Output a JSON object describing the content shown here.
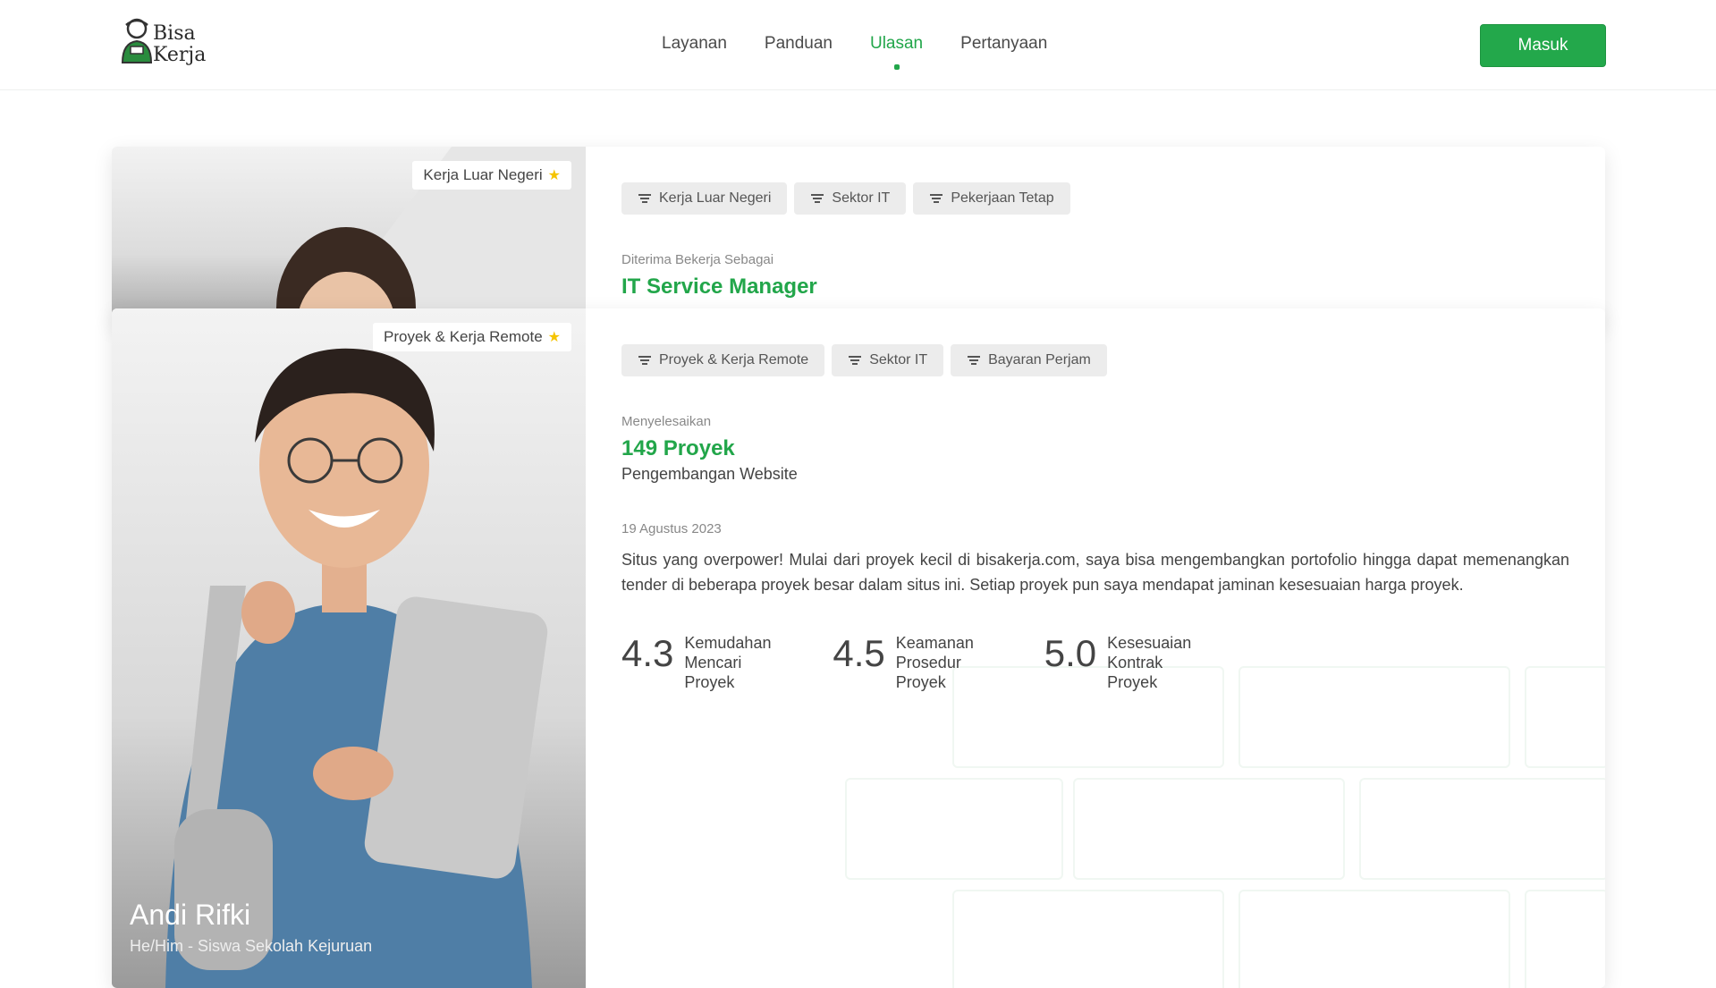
{
  "brand": {
    "line1": "Bisa",
    "line2": "Kerja"
  },
  "nav": {
    "items": [
      {
        "label": "Layanan",
        "active": false
      },
      {
        "label": "Panduan",
        "active": false
      },
      {
        "label": "Ulasan",
        "active": true
      },
      {
        "label": "Pertanyaan",
        "active": false
      }
    ]
  },
  "header": {
    "login_label": "Masuk"
  },
  "colors": {
    "accent": "#22a64a",
    "chip_bg": "#ececec",
    "star": "#f5c400"
  },
  "cards": [
    {
      "badge": "Kerja Luar Negeri",
      "chips": [
        "Kerja Luar Negeri",
        "Sektor IT",
        "Pekerjaan Tetap"
      ],
      "label": "Diterima Bekerja Sebagai",
      "highlight": "IT Service Manager"
    },
    {
      "badge": "Proyek & Kerja Remote",
      "chips": [
        "Proyek & Kerja Remote",
        "Sektor IT",
        "Bayaran Perjam"
      ],
      "label": "Menyelesaikan",
      "highlight": "149 Proyek",
      "sub": "Pengembangan Website",
      "date": "19 Agustus 2023",
      "review": "Situs yang overpower! Mulai dari proyek kecil di bisakerja.com, saya bisa mengembangkan portofolio hingga dapat memenangkan tender di beberapa proyek besar dalam situs ini. Setiap proyek pun saya mendapat jaminan kesesuaian harga proyek.",
      "ratings": [
        {
          "score": "4.3",
          "label": "Kemudahan Mencari Proyek"
        },
        {
          "score": "4.5",
          "label": "Keamanan Prosedur Proyek"
        },
        {
          "score": "5.0",
          "label": "Kesesuaian Kontrak Proyek"
        }
      ],
      "person": {
        "name": "Andi Rifki",
        "role": "He/Him - Siswa Sekolah Kejuruan"
      }
    }
  ]
}
